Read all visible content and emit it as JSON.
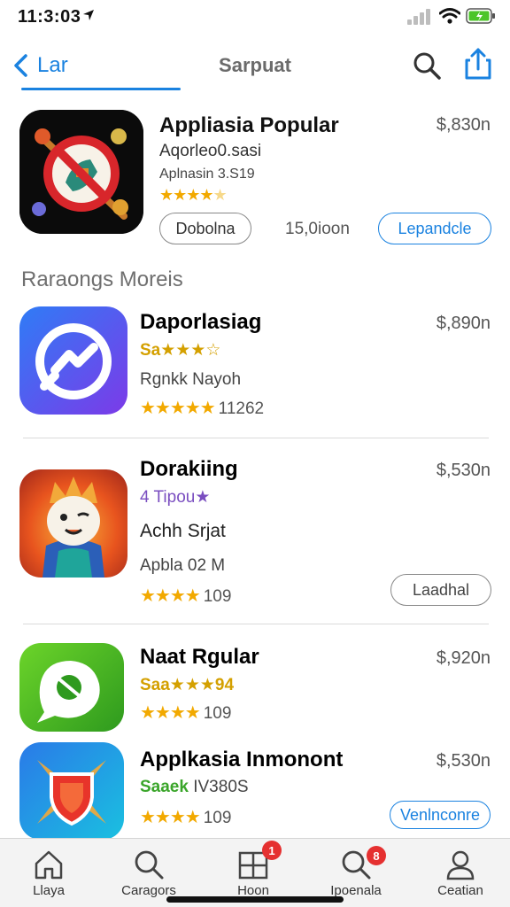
{
  "status_bar": {
    "time": "11:3:03"
  },
  "nav": {
    "back_label": "Lar",
    "title": "Sarpuat"
  },
  "featured": {
    "name": "Appliasia Popular",
    "price": "$,830n",
    "subtitle": "Aqorleo0.sasi",
    "meta": "Aplnasin 3.S19",
    "rating_stars": 4.5,
    "download_label": "Dobolna",
    "size": "15,0ioon",
    "expand_label": "Lepandcle"
  },
  "section": {
    "title": "Raraongs Moreis"
  },
  "apps": [
    {
      "name": "Daporlasiag",
      "price": "$,890n",
      "tagline": "Sa★★★☆",
      "line2": "Rgnkk Nayoh",
      "rating": "★★★★★",
      "rating_count": "11262"
    },
    {
      "name": "Dorakiing",
      "price": "$,530n",
      "tagline": "4 Tipou★",
      "line2": "Achh Srjat",
      "line3": "Apbla 02 M",
      "rating": "★★★★",
      "rating_count": "109",
      "action_label": "Laadhal"
    },
    {
      "name": "Naat Rgular",
      "price": "$,920n",
      "tagline": "Saa★★★94",
      "rating": "★★★★",
      "rating_count": "109"
    },
    {
      "name": "Applkasia Inmonont",
      "price": "$,530n",
      "tagline": "Saaek",
      "tagline_code": "IV380S",
      "rating": "★★★★",
      "rating_count": "109",
      "action_label": "Venlnconre"
    }
  ],
  "tabs": [
    {
      "label": "Llaya",
      "icon": "home-icon"
    },
    {
      "label": "Caragors",
      "icon": "search-icon"
    },
    {
      "label": "Hoon",
      "icon": "grid-icon",
      "badge": "1"
    },
    {
      "label": "Ipoenala",
      "icon": "search-icon",
      "badge": "8"
    },
    {
      "label": "Ceatian",
      "icon": "person-icon"
    }
  ],
  "colors": {
    "accent": "#1a82e0",
    "star": "#f2a900",
    "badge": "#e53030",
    "tagline_gold": "#d4a000",
    "tagline_purple": "#7a4ec0",
    "tagline_green": "#3aa52a"
  }
}
